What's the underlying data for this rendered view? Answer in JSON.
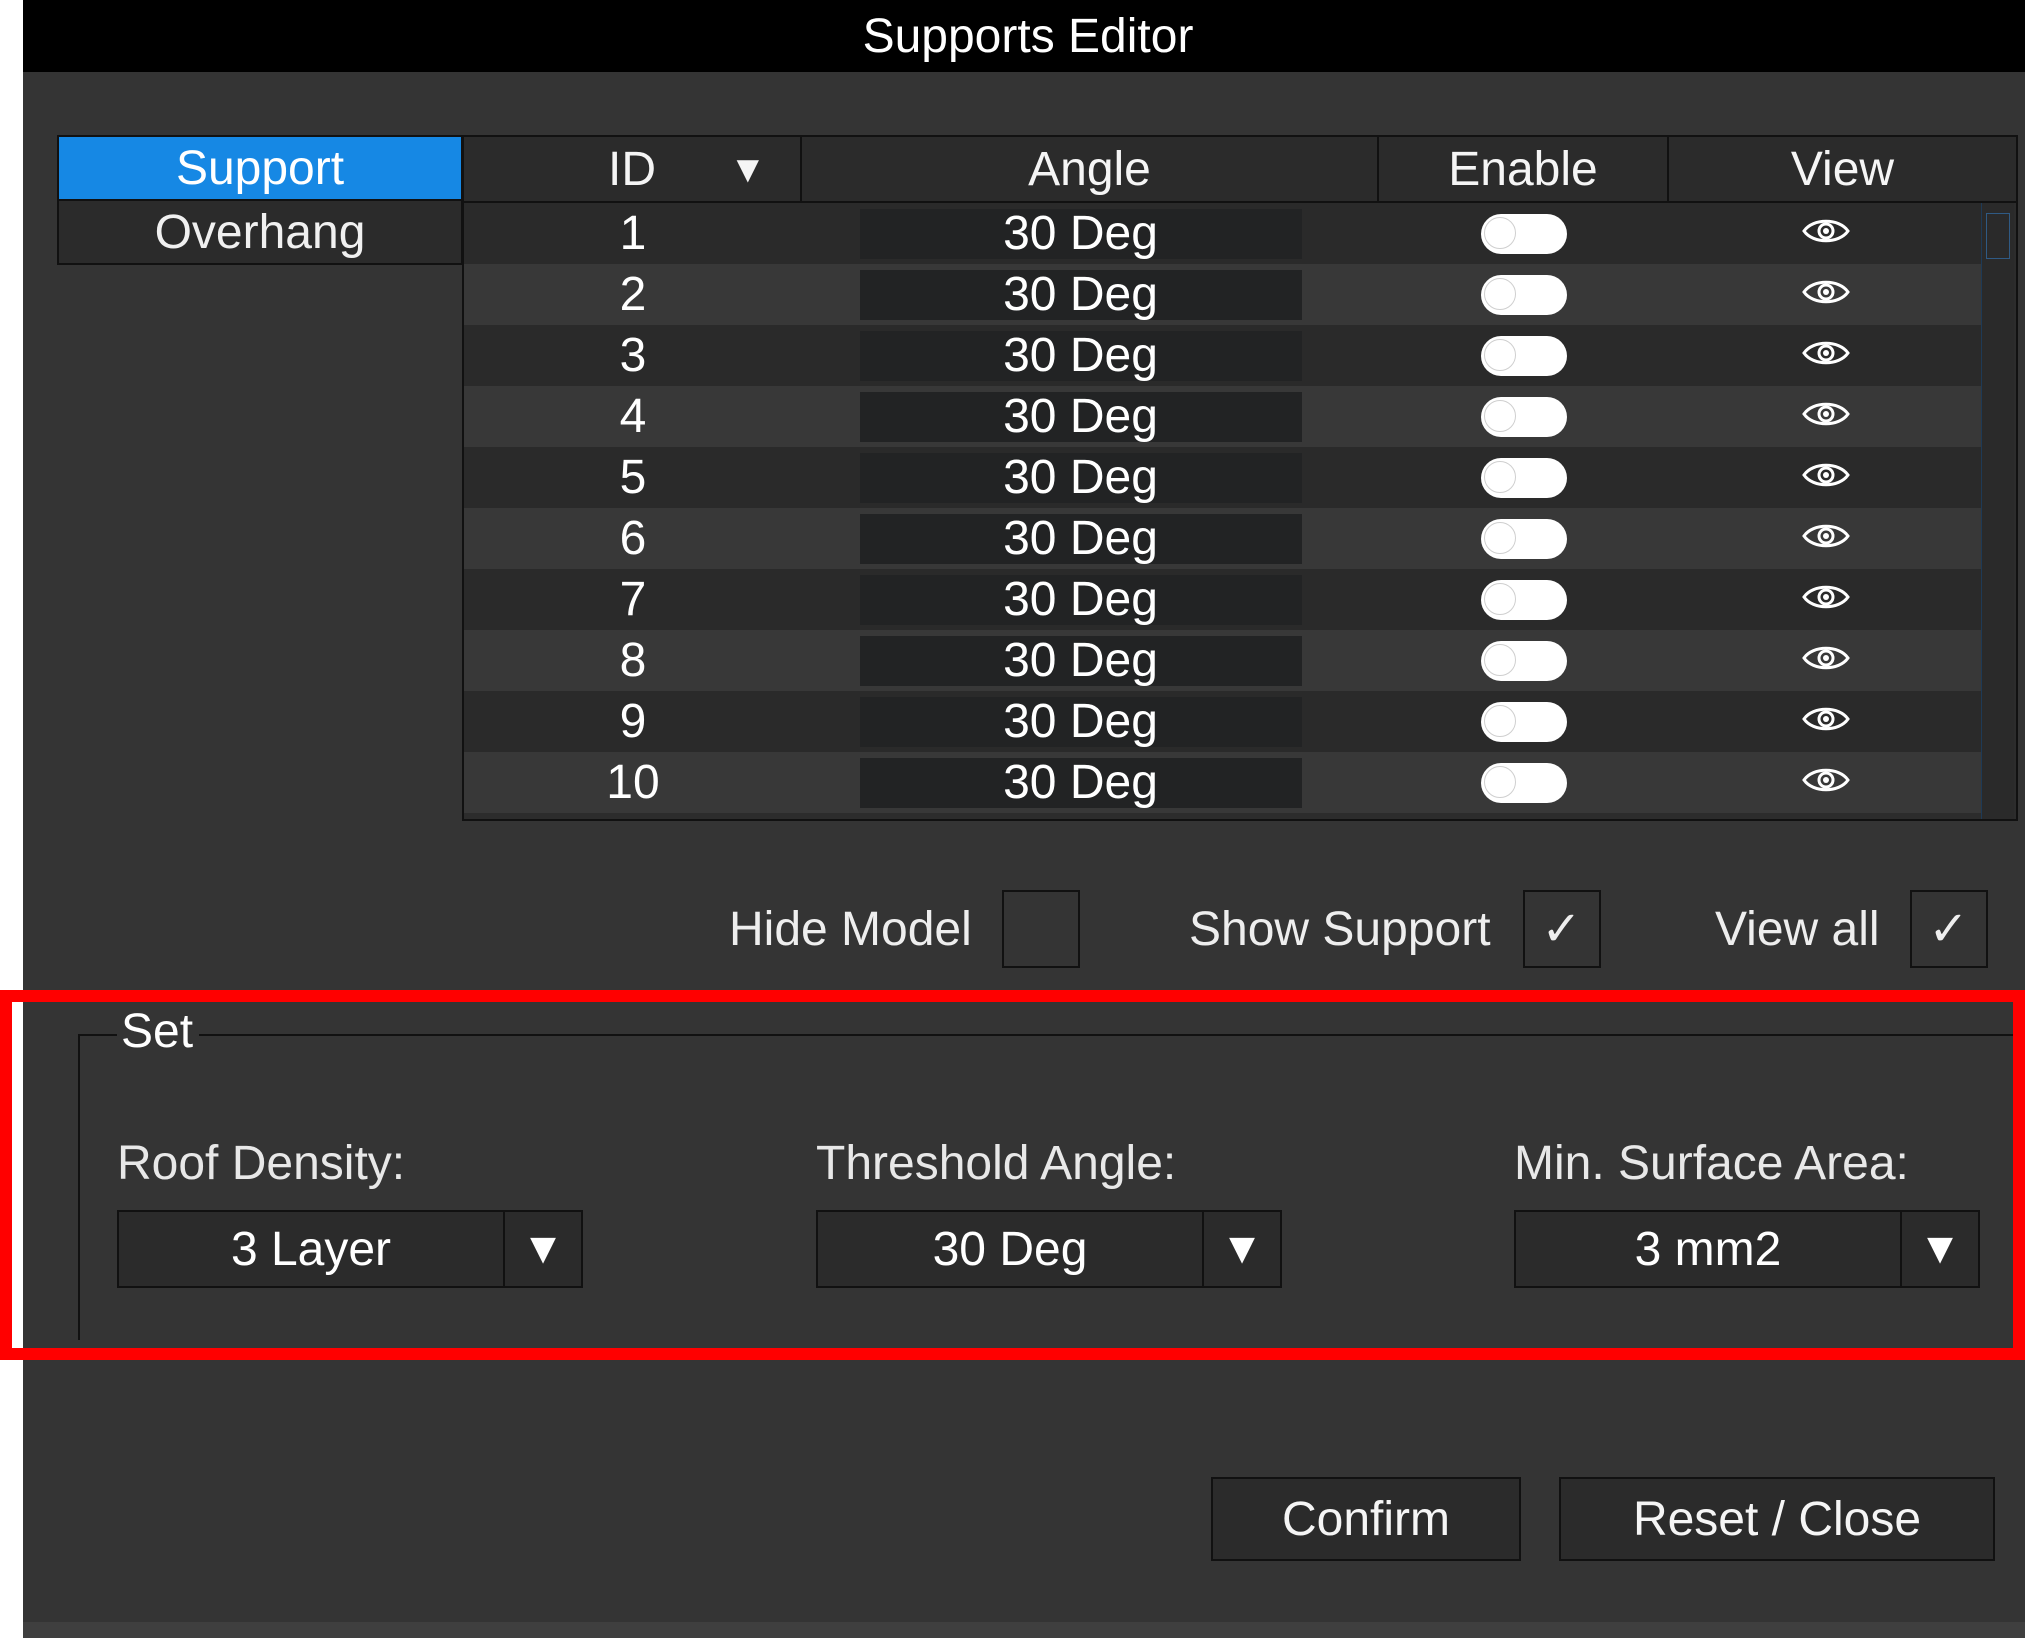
{
  "window": {
    "title": "Supports Editor"
  },
  "categories": [
    {
      "label": "Support",
      "active": true
    },
    {
      "label": "Overhang",
      "active": false
    }
  ],
  "table": {
    "columns": {
      "id": "ID",
      "angle": "Angle",
      "enable": "Enable",
      "view": "View"
    },
    "sort_indicator": "▼",
    "rows": [
      {
        "id": "1",
        "angle": "30 Deg",
        "enabled": false
      },
      {
        "id": "2",
        "angle": "30 Deg",
        "enabled": false
      },
      {
        "id": "3",
        "angle": "30 Deg",
        "enabled": false
      },
      {
        "id": "4",
        "angle": "30 Deg",
        "enabled": false
      },
      {
        "id": "5",
        "angle": "30 Deg",
        "enabled": false
      },
      {
        "id": "6",
        "angle": "30 Deg",
        "enabled": false
      },
      {
        "id": "7",
        "angle": "30 Deg",
        "enabled": false
      },
      {
        "id": "8",
        "angle": "30 Deg",
        "enabled": false
      },
      {
        "id": "9",
        "angle": "30 Deg",
        "enabled": false
      },
      {
        "id": "10",
        "angle": "30 Deg",
        "enabled": false
      }
    ],
    "view_icon": "eye-icon"
  },
  "options": {
    "hide_model": {
      "label": "Hide Model",
      "checked": false
    },
    "show_support": {
      "label": "Show Support",
      "checked": true
    },
    "view_all": {
      "label": "View all",
      "checked": true
    },
    "check_mark": "✓"
  },
  "set_group": {
    "legend": "Set",
    "roof_density": {
      "label": "Roof Density:",
      "value": "3 Layer"
    },
    "threshold_angle": {
      "label": "Threshold Angle:",
      "value": "30 Deg"
    },
    "min_surface_area": {
      "label": "Min. Surface Area:",
      "value": "3 mm2"
    },
    "dropdown_arrow": "▼"
  },
  "buttons": {
    "confirm": "Confirm",
    "reset_close": "Reset / Close"
  },
  "colors": {
    "accent": "#1688e4",
    "highlight": "#ff0000",
    "background": "#343434"
  }
}
